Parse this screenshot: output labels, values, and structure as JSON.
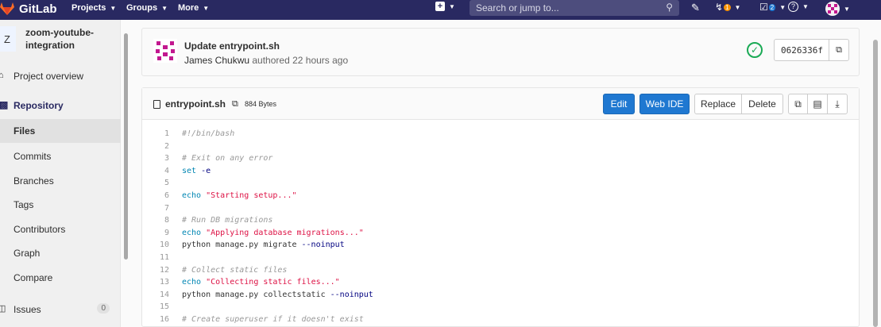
{
  "topbar": {
    "brand": "GitLab",
    "nav": [
      "Projects",
      "Groups",
      "More"
    ],
    "search_placeholder": "Search or jump to...",
    "merge_requests_count": "1",
    "todos_count": "2"
  },
  "sidebar": {
    "project_initial": "Z",
    "project_name_line1": "zoom-youtube-",
    "project_name_line2": "integration",
    "project_overview": "Project overview",
    "repository": "Repository",
    "items": [
      "Files",
      "Commits",
      "Branches",
      "Tags",
      "Contributors",
      "Graph",
      "Compare"
    ],
    "issues": "Issues",
    "issues_count": "0"
  },
  "commit": {
    "title": "Update entrypoint.sh",
    "author": "James Chukwu",
    "authored_text": "authored 22 hours ago",
    "sha": "0626336f"
  },
  "file": {
    "name": "entrypoint.sh",
    "size": "884 Bytes",
    "buttons": {
      "edit": "Edit",
      "web_ide": "Web IDE",
      "replace": "Replace",
      "delete": "Delete"
    }
  },
  "code_lines": [
    {
      "n": "1",
      "parts": [
        {
          "c": "cm",
          "t": "#!/bin/bash"
        }
      ]
    },
    {
      "n": "2",
      "parts": []
    },
    {
      "n": "3",
      "parts": [
        {
          "c": "cm",
          "t": "# Exit on any error"
        }
      ]
    },
    {
      "n": "4",
      "parts": [
        {
          "c": "kw",
          "t": "set"
        },
        {
          "c": "tx",
          "t": " "
        },
        {
          "c": "fl",
          "t": "-e"
        }
      ]
    },
    {
      "n": "5",
      "parts": []
    },
    {
      "n": "6",
      "parts": [
        {
          "c": "kw",
          "t": "echo"
        },
        {
          "c": "tx",
          "t": " "
        },
        {
          "c": "st",
          "t": "\"Starting setup...\""
        }
      ]
    },
    {
      "n": "7",
      "parts": []
    },
    {
      "n": "8",
      "parts": [
        {
          "c": "cm",
          "t": "# Run DB migrations"
        }
      ]
    },
    {
      "n": "9",
      "parts": [
        {
          "c": "kw",
          "t": "echo"
        },
        {
          "c": "tx",
          "t": " "
        },
        {
          "c": "st",
          "t": "\"Applying database migrations...\""
        }
      ]
    },
    {
      "n": "10",
      "parts": [
        {
          "c": "tx",
          "t": "python manage.py migrate "
        },
        {
          "c": "fl",
          "t": "--noinput"
        }
      ]
    },
    {
      "n": "11",
      "parts": []
    },
    {
      "n": "12",
      "parts": [
        {
          "c": "cm",
          "t": "# Collect static files"
        }
      ]
    },
    {
      "n": "13",
      "parts": [
        {
          "c": "kw",
          "t": "echo"
        },
        {
          "c": "tx",
          "t": " "
        },
        {
          "c": "st",
          "t": "\"Collecting static files...\""
        }
      ]
    },
    {
      "n": "14",
      "parts": [
        {
          "c": "tx",
          "t": "python manage.py collectstatic "
        },
        {
          "c": "fl",
          "t": "--noinput"
        }
      ]
    },
    {
      "n": "15",
      "parts": []
    },
    {
      "n": "16",
      "parts": [
        {
          "c": "cm",
          "t": "# Create superuser if it doesn't exist"
        }
      ]
    }
  ],
  "colors": {
    "topbar": "#292961",
    "primary_button": "#1f78d1",
    "success": "#1aaa55"
  },
  "icons": [
    "gitlab-logo-icon",
    "plus-icon",
    "search-icon",
    "issues-icon",
    "merge-request-icon",
    "todo-icon",
    "help-icon",
    "user-avatar-icon",
    "home-icon",
    "book-icon",
    "check-circle-icon",
    "copy-icon",
    "file-icon",
    "download-icon",
    "raw-icon"
  ]
}
